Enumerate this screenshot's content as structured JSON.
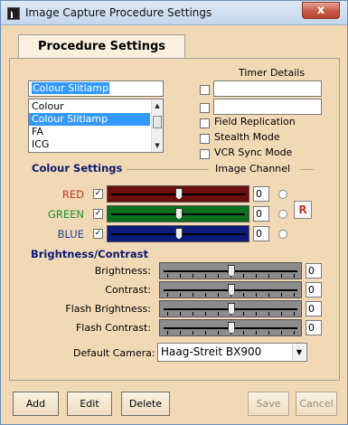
{
  "window": {
    "title": "Image Capture Procedure Settings",
    "close_glyph": "x",
    "bg_color": "#f2d9b6"
  },
  "tab": {
    "label": "Procedure Settings"
  },
  "procedure": {
    "name_value": "Colour Slitlamp",
    "list_items": [
      "Colour",
      "Colour Slitlamp",
      "FA",
      "ICG"
    ],
    "selected_index": 1
  },
  "timer": {
    "title": "Timer Details",
    "field1_value": "",
    "field2_value": "",
    "field1_checked": false,
    "field2_checked": false
  },
  "options": [
    {
      "label": "Field Replication",
      "checked": false
    },
    {
      "label": "Stealth Mode",
      "checked": false
    },
    {
      "label": "VCR Sync Mode",
      "checked": false
    }
  ],
  "colour_settings": {
    "title": "Colour Settings",
    "channel_title": "Image Channel",
    "channels": [
      {
        "label": "RED",
        "checked": true,
        "value": "0",
        "level": 0.5,
        "label_color": "#c0392b",
        "track_color": "#6e0f0f"
      },
      {
        "label": "GREEN",
        "checked": true,
        "value": "0",
        "level": 0.5,
        "label_color": "#1e8f2e",
        "track_color": "#0b6e1a"
      },
      {
        "label": "BLUE",
        "checked": true,
        "value": "0",
        "level": 0.5,
        "label_color": "#1f3f9f",
        "track_color": "#0c1b7a"
      }
    ],
    "r_button_label": "R"
  },
  "brightness_contrast": {
    "title": "Brightness/Contrast",
    "rows": [
      {
        "label": "Brightness:",
        "value": "0",
        "level": 0.5
      },
      {
        "label": "Contrast:",
        "value": "0",
        "level": 0.5
      },
      {
        "label": "Flash Brightness:",
        "value": "0",
        "level": 0.5
      },
      {
        "label": "Flash Contrast:",
        "value": "0",
        "level": 0.5
      }
    ]
  },
  "default_camera": {
    "label": "Default Camera:",
    "value": "Haag-Streit BX900"
  },
  "buttons": {
    "add": "Add",
    "edit": "Edit",
    "delete": "Delete",
    "save": "Save",
    "cancel": "Cancel"
  }
}
